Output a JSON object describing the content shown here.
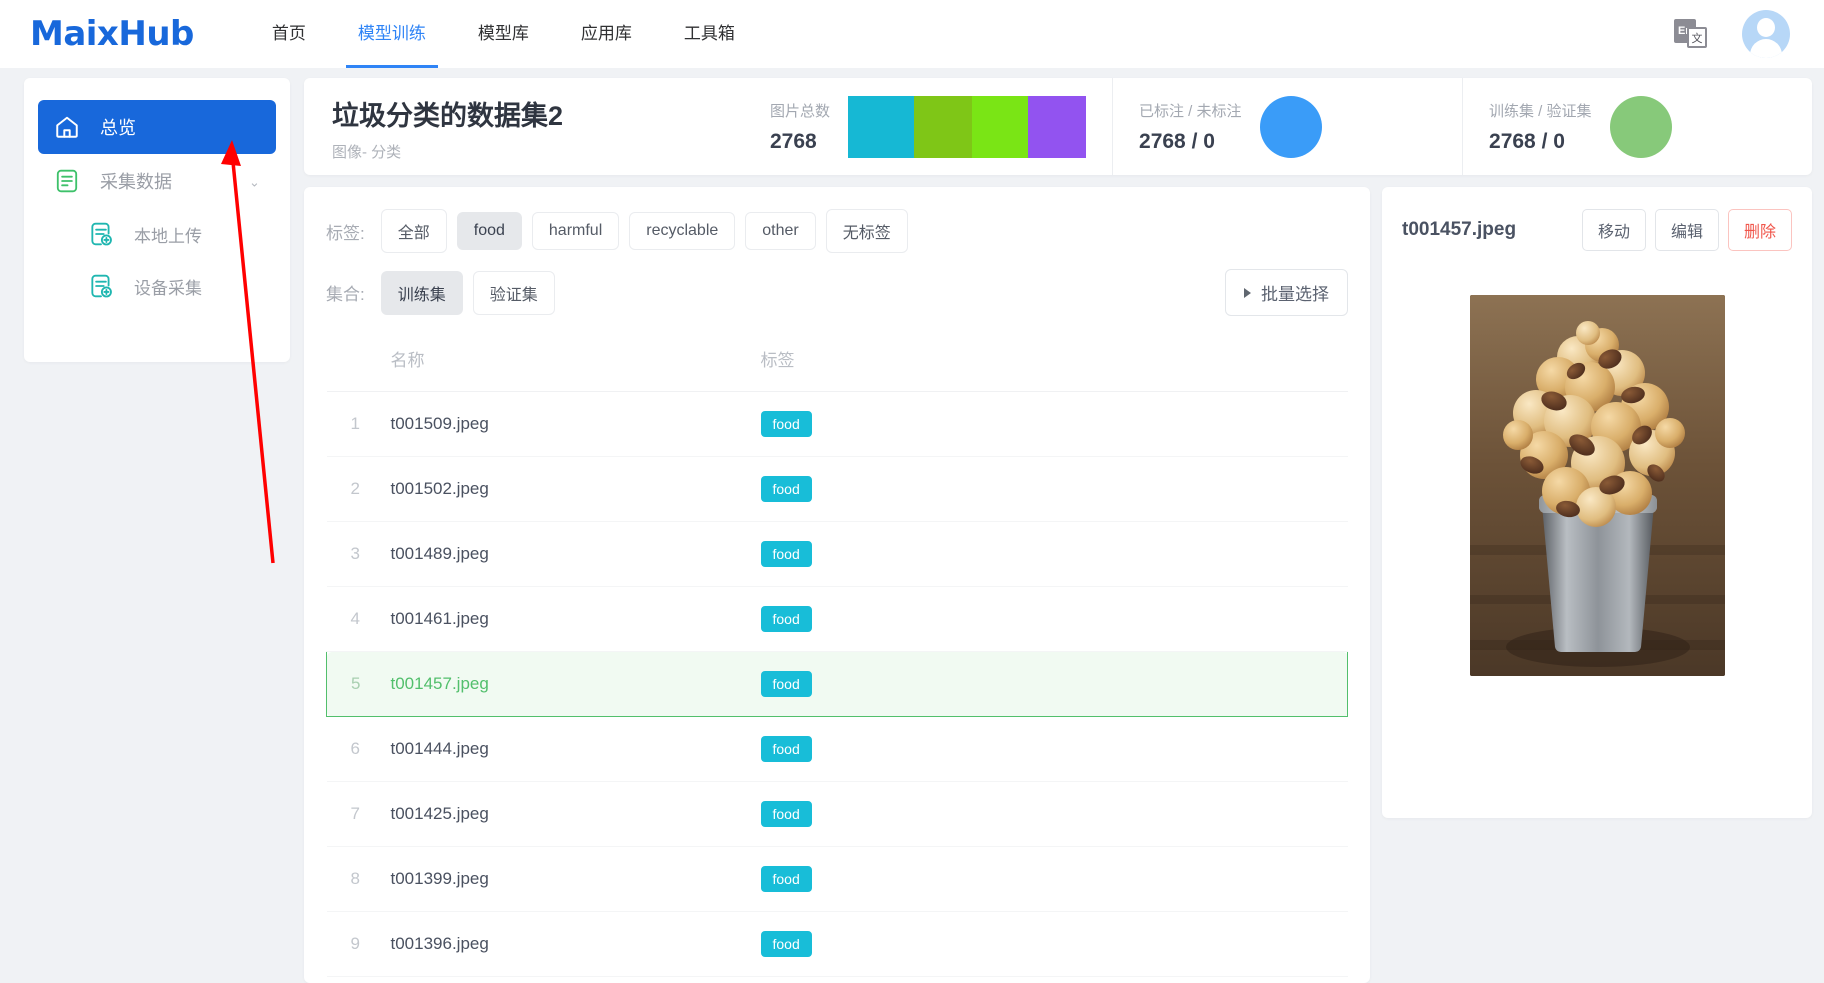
{
  "header": {
    "logo": "MaixHub",
    "nav": [
      {
        "label": "首页",
        "active": false
      },
      {
        "label": "模型训练",
        "active": true
      },
      {
        "label": "模型库",
        "active": false
      },
      {
        "label": "应用库",
        "active": false
      },
      {
        "label": "工具箱",
        "active": false
      }
    ],
    "lang_icon_text": "En",
    "lang_icon_glyph": "文",
    "accent_color": "#2f84f6"
  },
  "sidebar": {
    "items": [
      {
        "label": "总览",
        "icon": "home-icon",
        "active": true
      },
      {
        "label": "采集数据",
        "icon": "document-list-icon",
        "active": false,
        "caret": "⌃"
      },
      {
        "label": "本地上传",
        "icon": "document-add-icon",
        "active": false,
        "sub": true
      },
      {
        "label": "设备采集",
        "icon": "document-add-icon",
        "active": false,
        "sub": true
      }
    ]
  },
  "dataset": {
    "title": "垃圾分类的数据集2",
    "subtitle": "图像- 分类",
    "stats": [
      {
        "label": "图片总数",
        "value": "2768",
        "viz": "bar"
      },
      {
        "label": "已标注 / 未标注",
        "value": "2768 / 0",
        "viz": "dot",
        "color": "#3a9cf8"
      },
      {
        "label": "训练集 / 验证集",
        "value": "2768 / 0",
        "viz": "dot",
        "color": "#87c97a"
      }
    ],
    "bar_colors": [
      "#16b8d4",
      "#7fc617",
      "#7ae515",
      "#9253f0"
    ]
  },
  "filters": {
    "tag_label": "标签:",
    "tags": [
      {
        "label": "全部",
        "selected": false
      },
      {
        "label": "food",
        "selected": true
      },
      {
        "label": "harmful",
        "selected": false
      },
      {
        "label": "recyclable",
        "selected": false
      },
      {
        "label": "other",
        "selected": false
      },
      {
        "label": "无标签",
        "selected": false
      }
    ],
    "set_label": "集合:",
    "sets": [
      {
        "label": "训练集",
        "selected": true
      },
      {
        "label": "验证集",
        "selected": false
      }
    ],
    "batch_button": "批量选择"
  },
  "table": {
    "columns": [
      "",
      "名称",
      "标签"
    ],
    "rows": [
      {
        "index": "1",
        "name": "t001509.jpeg",
        "tag": "food",
        "selected": false
      },
      {
        "index": "2",
        "name": "t001502.jpeg",
        "tag": "food",
        "selected": false
      },
      {
        "index": "3",
        "name": "t001489.jpeg",
        "tag": "food",
        "selected": false
      },
      {
        "index": "4",
        "name": "t001461.jpeg",
        "tag": "food",
        "selected": false
      },
      {
        "index": "5",
        "name": "t001457.jpeg",
        "tag": "food",
        "selected": true
      },
      {
        "index": "6",
        "name": "t001444.jpeg",
        "tag": "food",
        "selected": false
      },
      {
        "index": "7",
        "name": "t001425.jpeg",
        "tag": "food",
        "selected": false
      },
      {
        "index": "8",
        "name": "t001399.jpeg",
        "tag": "food",
        "selected": false
      },
      {
        "index": "9",
        "name": "t001396.jpeg",
        "tag": "food",
        "selected": false
      }
    ],
    "tag_color": "#18bdd8",
    "selected_color": "#52bf6c"
  },
  "detail": {
    "filename": "t001457.jpeg",
    "buttons": [
      {
        "label": "移动",
        "style": "default"
      },
      {
        "label": "编辑",
        "style": "default"
      },
      {
        "label": "删除",
        "style": "danger"
      }
    ],
    "image_alt": "caramel popcorn in metal tin"
  },
  "annotation": {
    "arrow_color": "#ff0000",
    "description": "red arrow pointing to 总览 sidebar item"
  }
}
